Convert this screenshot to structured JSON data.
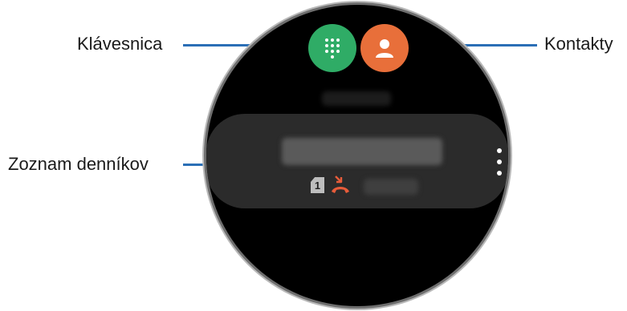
{
  "callouts": {
    "keypad": "Klávesnica",
    "contacts": "Kontakty",
    "call_log": "Zoznam denníkov"
  },
  "log_entry": {
    "sim_slot": "1"
  },
  "icons": {
    "keypad_button": "dialpad-icon",
    "contacts_button": "person-icon",
    "sim": "sim-card-icon",
    "call_status": "missed-call-icon",
    "more": "more-options-icon"
  },
  "colors": {
    "keypad_button": "#2fac66",
    "contacts_button": "#e86f3a",
    "missed_call": "#e85c3a",
    "leader_line": "#2b6fb6",
    "card": "#2b2b2b"
  }
}
